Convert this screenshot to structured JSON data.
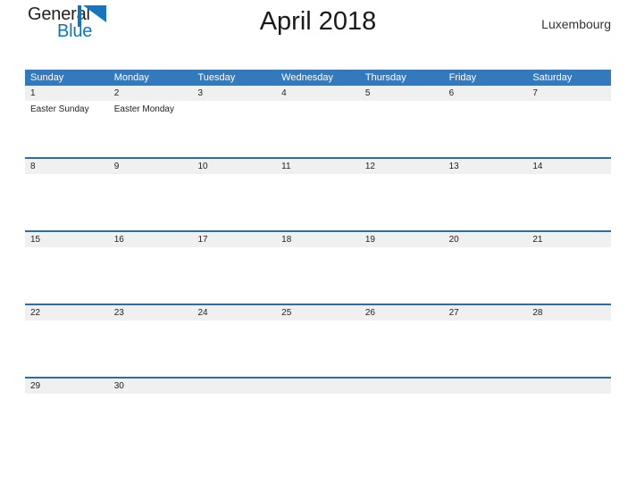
{
  "brand": {
    "name_part1": "General",
    "name_part2": "Blue",
    "logo_icon": "flag-triangle-icon",
    "accent_color": "#0e76bc"
  },
  "header": {
    "title": "April 2018",
    "region": "Luxembourg"
  },
  "theme": {
    "header_blue": "#3279be",
    "row_divider_blue": "#2e6da4",
    "day_band_gray": "#f0f0f0",
    "page_background": "#ffffff"
  },
  "calendar": {
    "month": "April",
    "year": "2018",
    "weekday_headers": [
      "Sunday",
      "Monday",
      "Tuesday",
      "Wednesday",
      "Thursday",
      "Friday",
      "Saturday"
    ],
    "weeks": [
      {
        "days": [
          {
            "date": "1",
            "event": "Easter Sunday"
          },
          {
            "date": "2",
            "event": "Easter Monday"
          },
          {
            "date": "3",
            "event": ""
          },
          {
            "date": "4",
            "event": ""
          },
          {
            "date": "5",
            "event": ""
          },
          {
            "date": "6",
            "event": ""
          },
          {
            "date": "7",
            "event": ""
          }
        ]
      },
      {
        "days": [
          {
            "date": "8",
            "event": ""
          },
          {
            "date": "9",
            "event": ""
          },
          {
            "date": "10",
            "event": ""
          },
          {
            "date": "11",
            "event": ""
          },
          {
            "date": "12",
            "event": ""
          },
          {
            "date": "13",
            "event": ""
          },
          {
            "date": "14",
            "event": ""
          }
        ]
      },
      {
        "days": [
          {
            "date": "15",
            "event": ""
          },
          {
            "date": "16",
            "event": ""
          },
          {
            "date": "17",
            "event": ""
          },
          {
            "date": "18",
            "event": ""
          },
          {
            "date": "19",
            "event": ""
          },
          {
            "date": "20",
            "event": ""
          },
          {
            "date": "21",
            "event": ""
          }
        ]
      },
      {
        "days": [
          {
            "date": "22",
            "event": ""
          },
          {
            "date": "23",
            "event": ""
          },
          {
            "date": "24",
            "event": ""
          },
          {
            "date": "25",
            "event": ""
          },
          {
            "date": "26",
            "event": ""
          },
          {
            "date": "27",
            "event": ""
          },
          {
            "date": "28",
            "event": ""
          }
        ]
      },
      {
        "days": [
          {
            "date": "29",
            "event": ""
          },
          {
            "date": "30",
            "event": ""
          },
          {
            "date": "",
            "event": ""
          },
          {
            "date": "",
            "event": ""
          },
          {
            "date": "",
            "event": ""
          },
          {
            "date": "",
            "event": ""
          },
          {
            "date": "",
            "event": ""
          }
        ]
      }
    ]
  }
}
